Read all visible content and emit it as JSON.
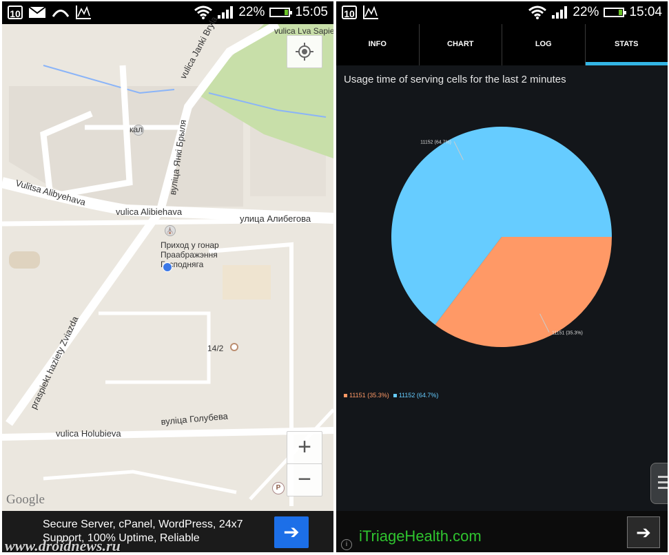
{
  "left_screen": {
    "status": {
      "calendar_day": "10",
      "battery": "22%",
      "time": "15:05",
      "battery_level": 0.22
    },
    "map": {
      "labels": {
        "street_janki": "vulica Janki Bryla",
        "street_lva": "vulica Lva Sapieh",
        "street_yanki_cyr": "вуліца Янкі Брыля",
        "street_alibyehava": "Vulitsa Alibyehava",
        "street_alibiehava": "vulica Alibiehava",
        "street_alibegova_ru": "улица Алибегова",
        "street_ziazda": "praspiekt haziety Zviazda",
        "street_holubieva": "vulica Holubieva",
        "street_holubieva_cyr": "вуліца Голубева",
        "poi_church_1": "Приход у гонар",
        "poi_church_2": "Праабражэння",
        "poi_church_3": "Гасподняга",
        "poi_kal": "кал",
        "house_number": "14/2",
        "parking": "P"
      },
      "google_logo": "Google",
      "zoom_in": "+",
      "zoom_out": "−"
    },
    "ad": {
      "text": "Secure Server, cPanel, WordPress, 24x7 Support, 100% Uptime, Reliable",
      "arrow": "➔"
    },
    "watermark": "www.droidnews.ru"
  },
  "right_screen": {
    "status": {
      "calendar_day": "10",
      "battery": "22%",
      "time": "15:04",
      "battery_level": 0.22
    },
    "tabs": [
      {
        "label": "INFO",
        "active": false
      },
      {
        "label": "CHART",
        "active": false
      },
      {
        "label": "LOG",
        "active": false
      },
      {
        "label": "STATS",
        "active": true
      }
    ],
    "chart_title": "Usage time of serving cells for the last 2 minutes",
    "chart_data": {
      "type": "pie",
      "title": "Usage time of serving cells for the last 2 minutes",
      "slices": [
        {
          "label": "11151 (35.3%)",
          "value": 35.3,
          "color": "#ff9966"
        },
        {
          "label": "11152 (64.7%)",
          "value": 64.7,
          "color": "#66ccff"
        }
      ],
      "legend": "bottom-left"
    },
    "bottom_bar": {
      "brand": "iTriageHealth.com",
      "info": "i",
      "arrow": "➔"
    }
  }
}
